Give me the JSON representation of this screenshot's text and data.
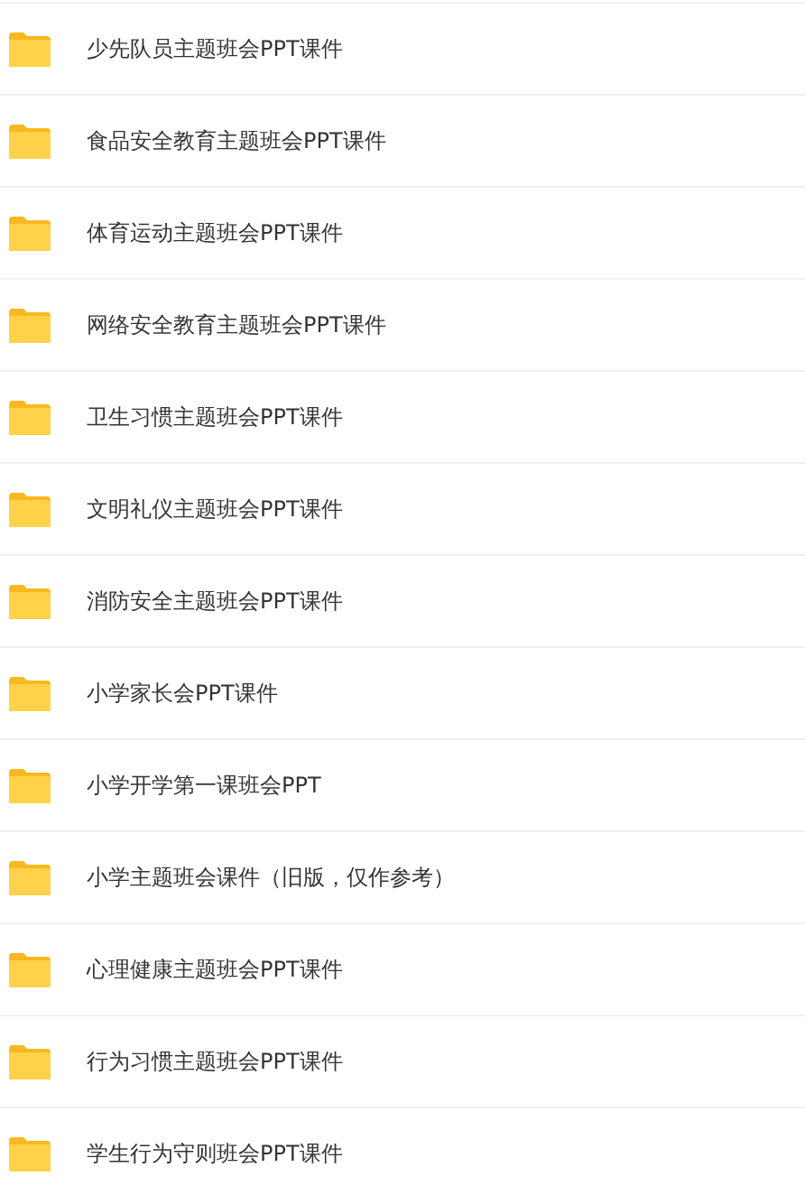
{
  "folders": [
    {
      "name": "少先队员主题班会PPT课件"
    },
    {
      "name": "食品安全教育主题班会PPT课件"
    },
    {
      "name": "体育运动主题班会PPT课件"
    },
    {
      "name": "网络安全教育主题班会PPT课件"
    },
    {
      "name": "卫生习惯主题班会PPT课件"
    },
    {
      "name": "文明礼仪主题班会PPT课件"
    },
    {
      "name": "消防安全主题班会PPT课件"
    },
    {
      "name": "小学家长会PPT课件"
    },
    {
      "name": "小学开学第一课班会PPT"
    },
    {
      "name": "小学主题班会课件（旧版，仅作参考）"
    },
    {
      "name": "心理健康主题班会PPT课件"
    },
    {
      "name": "行为习惯主题班会PPT课件"
    },
    {
      "name": "学生行为守则班会PPT课件"
    }
  ]
}
